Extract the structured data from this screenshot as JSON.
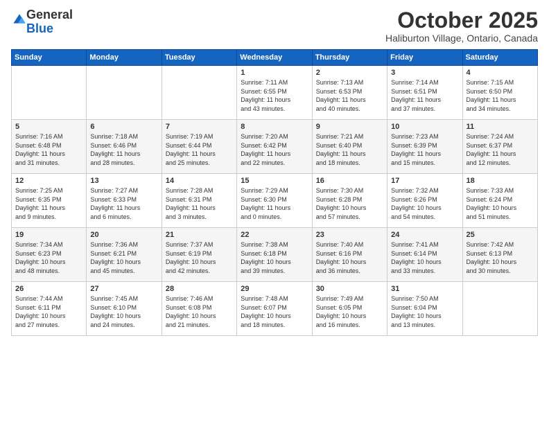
{
  "logo": {
    "general": "General",
    "blue": "Blue"
  },
  "title": "October 2025",
  "subtitle": "Haliburton Village, Ontario, Canada",
  "days_of_week": [
    "Sunday",
    "Monday",
    "Tuesday",
    "Wednesday",
    "Thursday",
    "Friday",
    "Saturday"
  ],
  "weeks": [
    [
      {
        "day": "",
        "info": ""
      },
      {
        "day": "",
        "info": ""
      },
      {
        "day": "",
        "info": ""
      },
      {
        "day": "1",
        "info": "Sunrise: 7:11 AM\nSunset: 6:55 PM\nDaylight: 11 hours\nand 43 minutes."
      },
      {
        "day": "2",
        "info": "Sunrise: 7:13 AM\nSunset: 6:53 PM\nDaylight: 11 hours\nand 40 minutes."
      },
      {
        "day": "3",
        "info": "Sunrise: 7:14 AM\nSunset: 6:51 PM\nDaylight: 11 hours\nand 37 minutes."
      },
      {
        "day": "4",
        "info": "Sunrise: 7:15 AM\nSunset: 6:50 PM\nDaylight: 11 hours\nand 34 minutes."
      }
    ],
    [
      {
        "day": "5",
        "info": "Sunrise: 7:16 AM\nSunset: 6:48 PM\nDaylight: 11 hours\nand 31 minutes."
      },
      {
        "day": "6",
        "info": "Sunrise: 7:18 AM\nSunset: 6:46 PM\nDaylight: 11 hours\nand 28 minutes."
      },
      {
        "day": "7",
        "info": "Sunrise: 7:19 AM\nSunset: 6:44 PM\nDaylight: 11 hours\nand 25 minutes."
      },
      {
        "day": "8",
        "info": "Sunrise: 7:20 AM\nSunset: 6:42 PM\nDaylight: 11 hours\nand 22 minutes."
      },
      {
        "day": "9",
        "info": "Sunrise: 7:21 AM\nSunset: 6:40 PM\nDaylight: 11 hours\nand 18 minutes."
      },
      {
        "day": "10",
        "info": "Sunrise: 7:23 AM\nSunset: 6:39 PM\nDaylight: 11 hours\nand 15 minutes."
      },
      {
        "day": "11",
        "info": "Sunrise: 7:24 AM\nSunset: 6:37 PM\nDaylight: 11 hours\nand 12 minutes."
      }
    ],
    [
      {
        "day": "12",
        "info": "Sunrise: 7:25 AM\nSunset: 6:35 PM\nDaylight: 11 hours\nand 9 minutes."
      },
      {
        "day": "13",
        "info": "Sunrise: 7:27 AM\nSunset: 6:33 PM\nDaylight: 11 hours\nand 6 minutes."
      },
      {
        "day": "14",
        "info": "Sunrise: 7:28 AM\nSunset: 6:31 PM\nDaylight: 11 hours\nand 3 minutes."
      },
      {
        "day": "15",
        "info": "Sunrise: 7:29 AM\nSunset: 6:30 PM\nDaylight: 11 hours\nand 0 minutes."
      },
      {
        "day": "16",
        "info": "Sunrise: 7:30 AM\nSunset: 6:28 PM\nDaylight: 10 hours\nand 57 minutes."
      },
      {
        "day": "17",
        "info": "Sunrise: 7:32 AM\nSunset: 6:26 PM\nDaylight: 10 hours\nand 54 minutes."
      },
      {
        "day": "18",
        "info": "Sunrise: 7:33 AM\nSunset: 6:24 PM\nDaylight: 10 hours\nand 51 minutes."
      }
    ],
    [
      {
        "day": "19",
        "info": "Sunrise: 7:34 AM\nSunset: 6:23 PM\nDaylight: 10 hours\nand 48 minutes."
      },
      {
        "day": "20",
        "info": "Sunrise: 7:36 AM\nSunset: 6:21 PM\nDaylight: 10 hours\nand 45 minutes."
      },
      {
        "day": "21",
        "info": "Sunrise: 7:37 AM\nSunset: 6:19 PM\nDaylight: 10 hours\nand 42 minutes."
      },
      {
        "day": "22",
        "info": "Sunrise: 7:38 AM\nSunset: 6:18 PM\nDaylight: 10 hours\nand 39 minutes."
      },
      {
        "day": "23",
        "info": "Sunrise: 7:40 AM\nSunset: 6:16 PM\nDaylight: 10 hours\nand 36 minutes."
      },
      {
        "day": "24",
        "info": "Sunrise: 7:41 AM\nSunset: 6:14 PM\nDaylight: 10 hours\nand 33 minutes."
      },
      {
        "day": "25",
        "info": "Sunrise: 7:42 AM\nSunset: 6:13 PM\nDaylight: 10 hours\nand 30 minutes."
      }
    ],
    [
      {
        "day": "26",
        "info": "Sunrise: 7:44 AM\nSunset: 6:11 PM\nDaylight: 10 hours\nand 27 minutes."
      },
      {
        "day": "27",
        "info": "Sunrise: 7:45 AM\nSunset: 6:10 PM\nDaylight: 10 hours\nand 24 minutes."
      },
      {
        "day": "28",
        "info": "Sunrise: 7:46 AM\nSunset: 6:08 PM\nDaylight: 10 hours\nand 21 minutes."
      },
      {
        "day": "29",
        "info": "Sunrise: 7:48 AM\nSunset: 6:07 PM\nDaylight: 10 hours\nand 18 minutes."
      },
      {
        "day": "30",
        "info": "Sunrise: 7:49 AM\nSunset: 6:05 PM\nDaylight: 10 hours\nand 16 minutes."
      },
      {
        "day": "31",
        "info": "Sunrise: 7:50 AM\nSunset: 6:04 PM\nDaylight: 10 hours\nand 13 minutes."
      },
      {
        "day": "",
        "info": ""
      }
    ]
  ]
}
